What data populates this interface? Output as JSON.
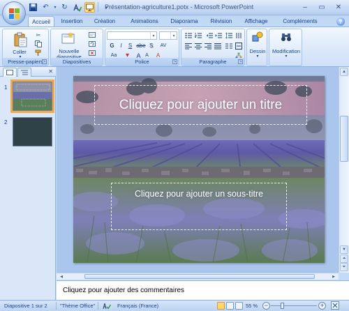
{
  "app": {
    "title": "Présentation-agriculture1.potx - Microsoft PowerPoint"
  },
  "quick_access": {
    "save_icon": "save-icon",
    "undo_icon": "undo-icon",
    "redo_icon": "redo-icon",
    "customize_icon": "customize-qat-icon"
  },
  "tabs": [
    {
      "label": "Accueil",
      "active": true
    },
    {
      "label": "Insertion"
    },
    {
      "label": "Création"
    },
    {
      "label": "Animations"
    },
    {
      "label": "Diaporama"
    },
    {
      "label": "Révision"
    },
    {
      "label": "Affichage"
    },
    {
      "label": "Compléments"
    }
  ],
  "ribbon": {
    "clipboard": {
      "paste_label": "Coller",
      "group_label": "Presse-papiers"
    },
    "slides": {
      "new_slide_label_1": "Nouvelle",
      "new_slide_label_2": "diapositive",
      "group_label": "Diapositives"
    },
    "font": {
      "group_label": "Police",
      "bold": "G",
      "italic": "I",
      "underline": "S",
      "strike": "abe",
      "spacing": "AV",
      "case": "Aa",
      "grow": "A",
      "shrink": "A",
      "clear": "A"
    },
    "paragraph": {
      "group_label": "Paragraphe"
    },
    "drawing": {
      "label": "Dessin"
    },
    "editing": {
      "label": "Modification"
    }
  },
  "slides_pane": {
    "slides": [
      {
        "number": "1",
        "selected": true
      },
      {
        "number": "2",
        "selected": false
      }
    ]
  },
  "slide": {
    "title_placeholder": "Cliquez pour ajouter un titre",
    "subtitle_placeholder": "Cliquez pour ajouter un sous-titre"
  },
  "notes": {
    "placeholder": "Cliquez pour ajouter des commentaires"
  },
  "status_bar": {
    "slide_info": "Diapositive 1 sur 2",
    "theme": "\"Thème Office\"",
    "language": "Français (France)",
    "zoom": "55 %",
    "zoom_fraction": 0.55
  },
  "colors": {
    "ribbon_blue": "#15428b",
    "accent_orange": "#f1a94a"
  }
}
